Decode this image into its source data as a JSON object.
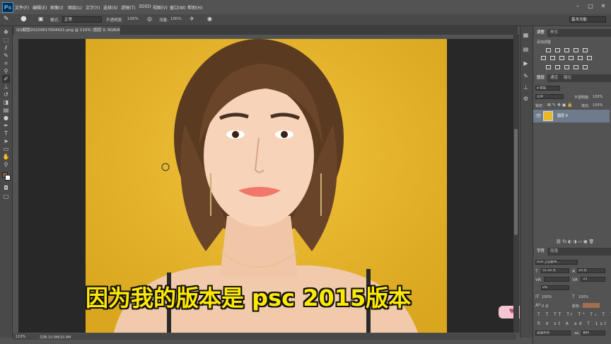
{
  "app": {
    "logo": "Ps"
  },
  "menu": [
    "文件(F)",
    "编辑(E)",
    "图像(I)",
    "图层(L)",
    "文字(Y)",
    "选择(S)",
    "滤镜(T)",
    "3D(D)",
    "视图(V)",
    "窗口(W)",
    "帮助(H)"
  ],
  "options": {
    "mode_label": "模式:",
    "mode_value": "正常",
    "opacity_label": "不透明度:",
    "opacity_value": "100%",
    "flow_label": "流量:",
    "flow_value": "100%",
    "workspace": "基本功能"
  },
  "document": {
    "tab_title": "QQ截图20220617004421.png @ 110% (图层 0, RGB/8#) *",
    "zoom": "110%",
    "doc_info": "文档:10.9M/10.9M"
  },
  "subtitle": "因为我的版本是 psc 2015版本",
  "adjustments_panel": {
    "tabs": [
      "调整",
      "样式"
    ],
    "add_label": "添加调整"
  },
  "layers_panel": {
    "tabs": [
      "图层",
      "通道",
      "路径"
    ],
    "kind": "ρ 类型",
    "blend": "正常",
    "opacity_label": "不透明度:",
    "opacity_value": "100%",
    "lock_label": "锁定:",
    "fill_label": "填充:",
    "fill_value": "100%",
    "layer_name": "图层 0"
  },
  "character_panel": {
    "tabs": [
      "字符",
      "段落"
    ],
    "font": "019-上首板书...",
    "size": "55.18 点",
    "leading": "20 点",
    "tracking": "-25",
    "scale": "0%",
    "v_scale": "100%",
    "h_scale": "100%",
    "baseline": "0 点",
    "color_label": "颜色:",
    "language": "美国英语",
    "aa": "锐利"
  },
  "colors": {
    "foreground": "#8a5a3a",
    "background": "#ffffff",
    "photo_bg": "#e9b829",
    "text_color": "#a07050"
  }
}
